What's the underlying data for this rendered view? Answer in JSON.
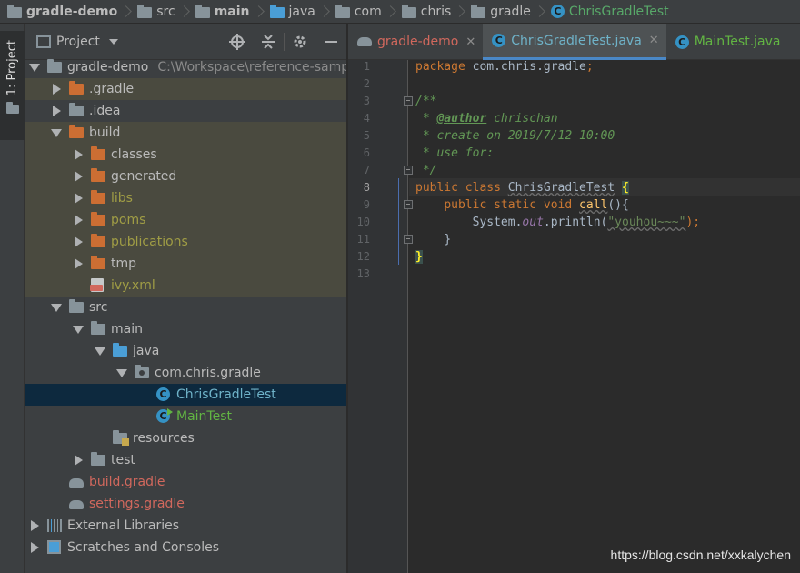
{
  "breadcrumb": {
    "items": [
      "gradle-demo",
      "src",
      "main",
      "java",
      "com",
      "chris",
      "gradle",
      "ChrisGradleTest"
    ]
  },
  "sidebar": {
    "tool_label": "1: Project"
  },
  "project_panel": {
    "title": "Project"
  },
  "tree": [
    {
      "label": "gradle-demo",
      "path": "C:\\Workspace\\reference-sampl"
    },
    {
      "label": ".gradle"
    },
    {
      "label": ".idea"
    },
    {
      "label": "build"
    },
    {
      "label": "classes"
    },
    {
      "label": "generated"
    },
    {
      "label": "libs"
    },
    {
      "label": "poms"
    },
    {
      "label": "publications"
    },
    {
      "label": "tmp"
    },
    {
      "label": "ivy.xml"
    },
    {
      "label": "src"
    },
    {
      "label": "main"
    },
    {
      "label": "java"
    },
    {
      "label": "com.chris.gradle"
    },
    {
      "label": "ChrisGradleTest"
    },
    {
      "label": "MainTest"
    },
    {
      "label": "resources"
    },
    {
      "label": "test"
    },
    {
      "label": "build.gradle"
    },
    {
      "label": "settings.gradle"
    },
    {
      "label": "External Libraries"
    },
    {
      "label": "Scratches and Consoles"
    }
  ],
  "tabs": [
    "gradle-demo",
    "ChrisGradleTest.java",
    "MainTest.java"
  ],
  "editor": {
    "line_numbers": [
      "1",
      "2",
      "3",
      "4",
      "5",
      "6",
      "7",
      "8",
      "9",
      "10",
      "11",
      "12",
      "13"
    ],
    "code": {
      "kw_package": "package",
      "package_name": "com.chris.gradle",
      "semicolon": ";",
      "doc_open": "/**",
      "doc_star": " * ",
      "author_tag": "@author",
      "author_name": " chrischan",
      "doc_create": " * create on 2019/7/12 10:00",
      "doc_use": " * use for:",
      "doc_close": " */",
      "kw_public": "public",
      "kw_class": "class",
      "class_name": "ChrisGradleTest",
      "brace_open": "{",
      "kw_static": "static",
      "kw_void": "void",
      "method_name": "call",
      "method_sig": "(){",
      "system": "System.",
      "out": "out",
      "println": ".println(",
      "string": "\"youhou~~~\"",
      "call_end": ");",
      "brace_close": "}"
    }
  },
  "watermark": "https://blog.csdn.net/xxkalychen",
  "colors": {
    "accent": "#4a88c7",
    "keyword": "#cc7832",
    "comment": "#629755",
    "selection": "#0d293e"
  }
}
